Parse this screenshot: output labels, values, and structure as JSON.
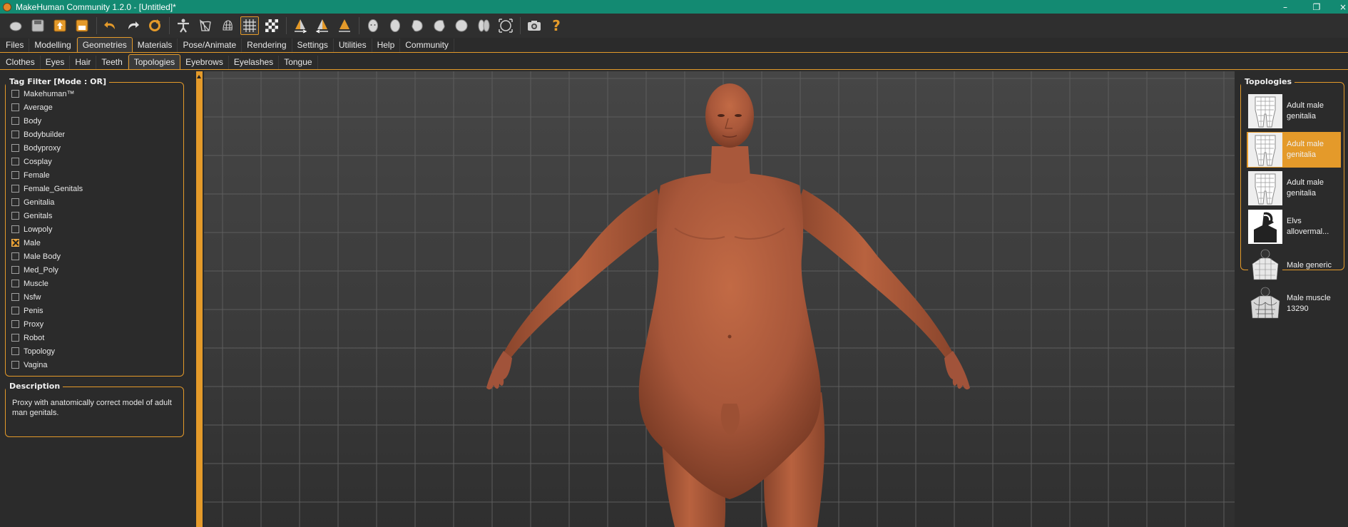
{
  "window": {
    "title": "MakeHuman Community 1.2.0 - [Untitled]*",
    "minimize": "–",
    "restore": "❐",
    "close": "×"
  },
  "toolbar": {
    "icons": [
      "new-icon",
      "save-icon",
      "export-icon",
      "load-icon",
      "undo-icon",
      "redo-icon",
      "reset-icon",
      "pose-icon",
      "wireframe-icon",
      "grid-icon",
      "checker-icon",
      "symmetry-right-icon",
      "symmetry-left-icon",
      "symmetry-icon",
      "front-view-icon",
      "back-view-icon",
      "left-view-icon",
      "right-view-icon",
      "top-view-icon",
      "bottom-view-icon",
      "reset-camera-icon",
      "screenshot-icon",
      "help-icon"
    ],
    "help_label": "?"
  },
  "main_tabs": [
    "Files",
    "Modelling",
    "Geometries",
    "Materials",
    "Pose/Animate",
    "Rendering",
    "Settings",
    "Utilities",
    "Help",
    "Community"
  ],
  "main_tab_active": "Geometries",
  "sub_tabs": [
    "Clothes",
    "Eyes",
    "Hair",
    "Teeth",
    "Topologies",
    "Eyebrows",
    "Eyelashes",
    "Tongue"
  ],
  "sub_tab_active": "Topologies",
  "tag_filter": {
    "title": "Tag Filter [Mode : OR]",
    "tags": [
      {
        "label": "Makehuman™",
        "checked": false
      },
      {
        "label": "Average",
        "checked": false
      },
      {
        "label": "Body",
        "checked": false
      },
      {
        "label": "Bodybuilder",
        "checked": false
      },
      {
        "label": "Bodyproxy",
        "checked": false
      },
      {
        "label": "Cosplay",
        "checked": false
      },
      {
        "label": "Female",
        "checked": false
      },
      {
        "label": "Female_Genitals",
        "checked": false
      },
      {
        "label": "Genitalia",
        "checked": false
      },
      {
        "label": "Genitals",
        "checked": false
      },
      {
        "label": "Lowpoly",
        "checked": false
      },
      {
        "label": "Male",
        "checked": true
      },
      {
        "label": "Male Body",
        "checked": false
      },
      {
        "label": "Med_Poly",
        "checked": false
      },
      {
        "label": "Muscle",
        "checked": false
      },
      {
        "label": "Nsfw",
        "checked": false
      },
      {
        "label": "Penis",
        "checked": false
      },
      {
        "label": "Proxy",
        "checked": false
      },
      {
        "label": "Robot",
        "checked": false
      },
      {
        "label": "Topology",
        "checked": false
      },
      {
        "label": "Vagina",
        "checked": false
      }
    ]
  },
  "description": {
    "title": "Description",
    "text": "Proxy with anatomically correct model of adult man genitals."
  },
  "topologies": {
    "title": "Topologies",
    "items": [
      {
        "label": "Adult male genitalia",
        "selected": false
      },
      {
        "label": "Adult male genitalia",
        "selected": true
      },
      {
        "label": "Adult male genitalia",
        "selected": false
      },
      {
        "label": "Elvs allovermal...",
        "selected": false
      },
      {
        "label": "Male generic",
        "selected": false
      },
      {
        "label": "Male muscle 13290",
        "selected": false
      }
    ]
  },
  "colors": {
    "accent": "#e49a2a",
    "titlebar": "#138a72",
    "background": "#2b2b2b",
    "skin": "#b25d3c"
  }
}
